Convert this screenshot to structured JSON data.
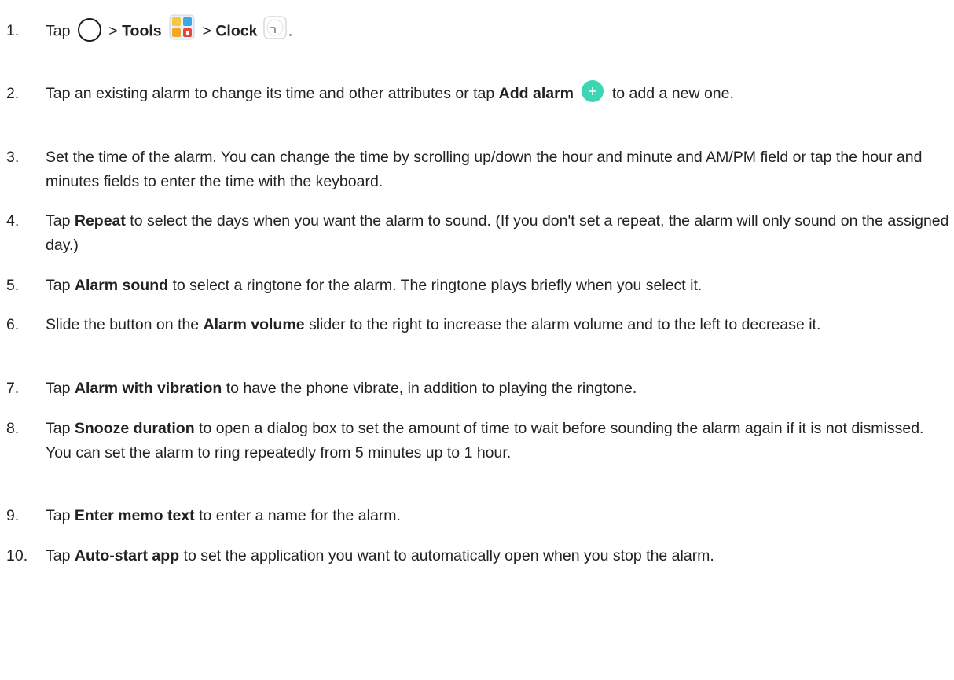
{
  "steps": [
    {
      "number": "1.",
      "parts": [
        {
          "t": "Tap "
        },
        {
          "icon": "home-circle-icon"
        },
        {
          "t": " > "
        },
        {
          "b": "Tools"
        },
        {
          "t": " "
        },
        {
          "icon": "tools-folder-icon"
        },
        {
          "t": " > "
        },
        {
          "b": "Clock"
        },
        {
          "t": " "
        },
        {
          "icon": "clock-app-icon"
        },
        {
          "t": "."
        }
      ]
    },
    {
      "number": "2.",
      "parts": [
        {
          "t": "Tap an existing alarm to change its time and other attributes or tap "
        },
        {
          "b": "Add alarm"
        },
        {
          "t": " "
        },
        {
          "icon": "add-alarm-plus-icon"
        },
        {
          "t": " to add a new one."
        }
      ]
    },
    {
      "number": "3.",
      "parts": [
        {
          "t": "Set the time of the alarm. You can change the time by scrolling up/down the hour and minute and AM/PM field or tap the hour and minutes fields to enter the time with the keyboard."
        }
      ]
    },
    {
      "number": "4.",
      "parts": [
        {
          "t": "Tap "
        },
        {
          "b": "Repeat"
        },
        {
          "t": " to select the days when you want the alarm to sound. (If you don't set a repeat, the alarm will only sound on the assigned day.)"
        }
      ]
    },
    {
      "number": "5.",
      "parts": [
        {
          "t": "Tap "
        },
        {
          "b": "Alarm sound"
        },
        {
          "t": " to select a ringtone for the alarm. The ringtone plays briefly when you select it."
        }
      ]
    },
    {
      "number": "6.",
      "parts": [
        {
          "t": "Slide the button on the "
        },
        {
          "b": "Alarm volume"
        },
        {
          "t": " slider to the right to increase the alarm volume and to the left to decrease it."
        }
      ]
    },
    {
      "number": "7.",
      "parts": [
        {
          "t": "Tap "
        },
        {
          "b": "Alarm with vibration"
        },
        {
          "t": " to have the phone vibrate, in addition to playing the ringtone."
        }
      ]
    },
    {
      "number": "8.",
      "parts": [
        {
          "t": "Tap "
        },
        {
          "b": "Snooze duration"
        },
        {
          "t": " to open a dialog box to set the amount of time to wait before sounding the alarm again if it is not dismissed. You can set the alarm to ring repeatedly from 5 minutes up to 1 hour."
        }
      ]
    },
    {
      "number": "9.",
      "parts": [
        {
          "t": "Tap "
        },
        {
          "b": "Enter memo text"
        },
        {
          "t": " to enter a name for the alarm."
        }
      ]
    },
    {
      "number": "10.",
      "parts": [
        {
          "t": "Tap "
        },
        {
          "b": "Auto-start app"
        },
        {
          "t": " to set the application you want to automatically open when you stop the alarm."
        }
      ]
    }
  ],
  "colors": {
    "text": "#222222",
    "add_icon": "#3dd6b5",
    "tools_folder_yellow": "#f5c73d",
    "tools_folder_blue": "#3aa8e8",
    "tools_folder_red": "#e8453c"
  }
}
